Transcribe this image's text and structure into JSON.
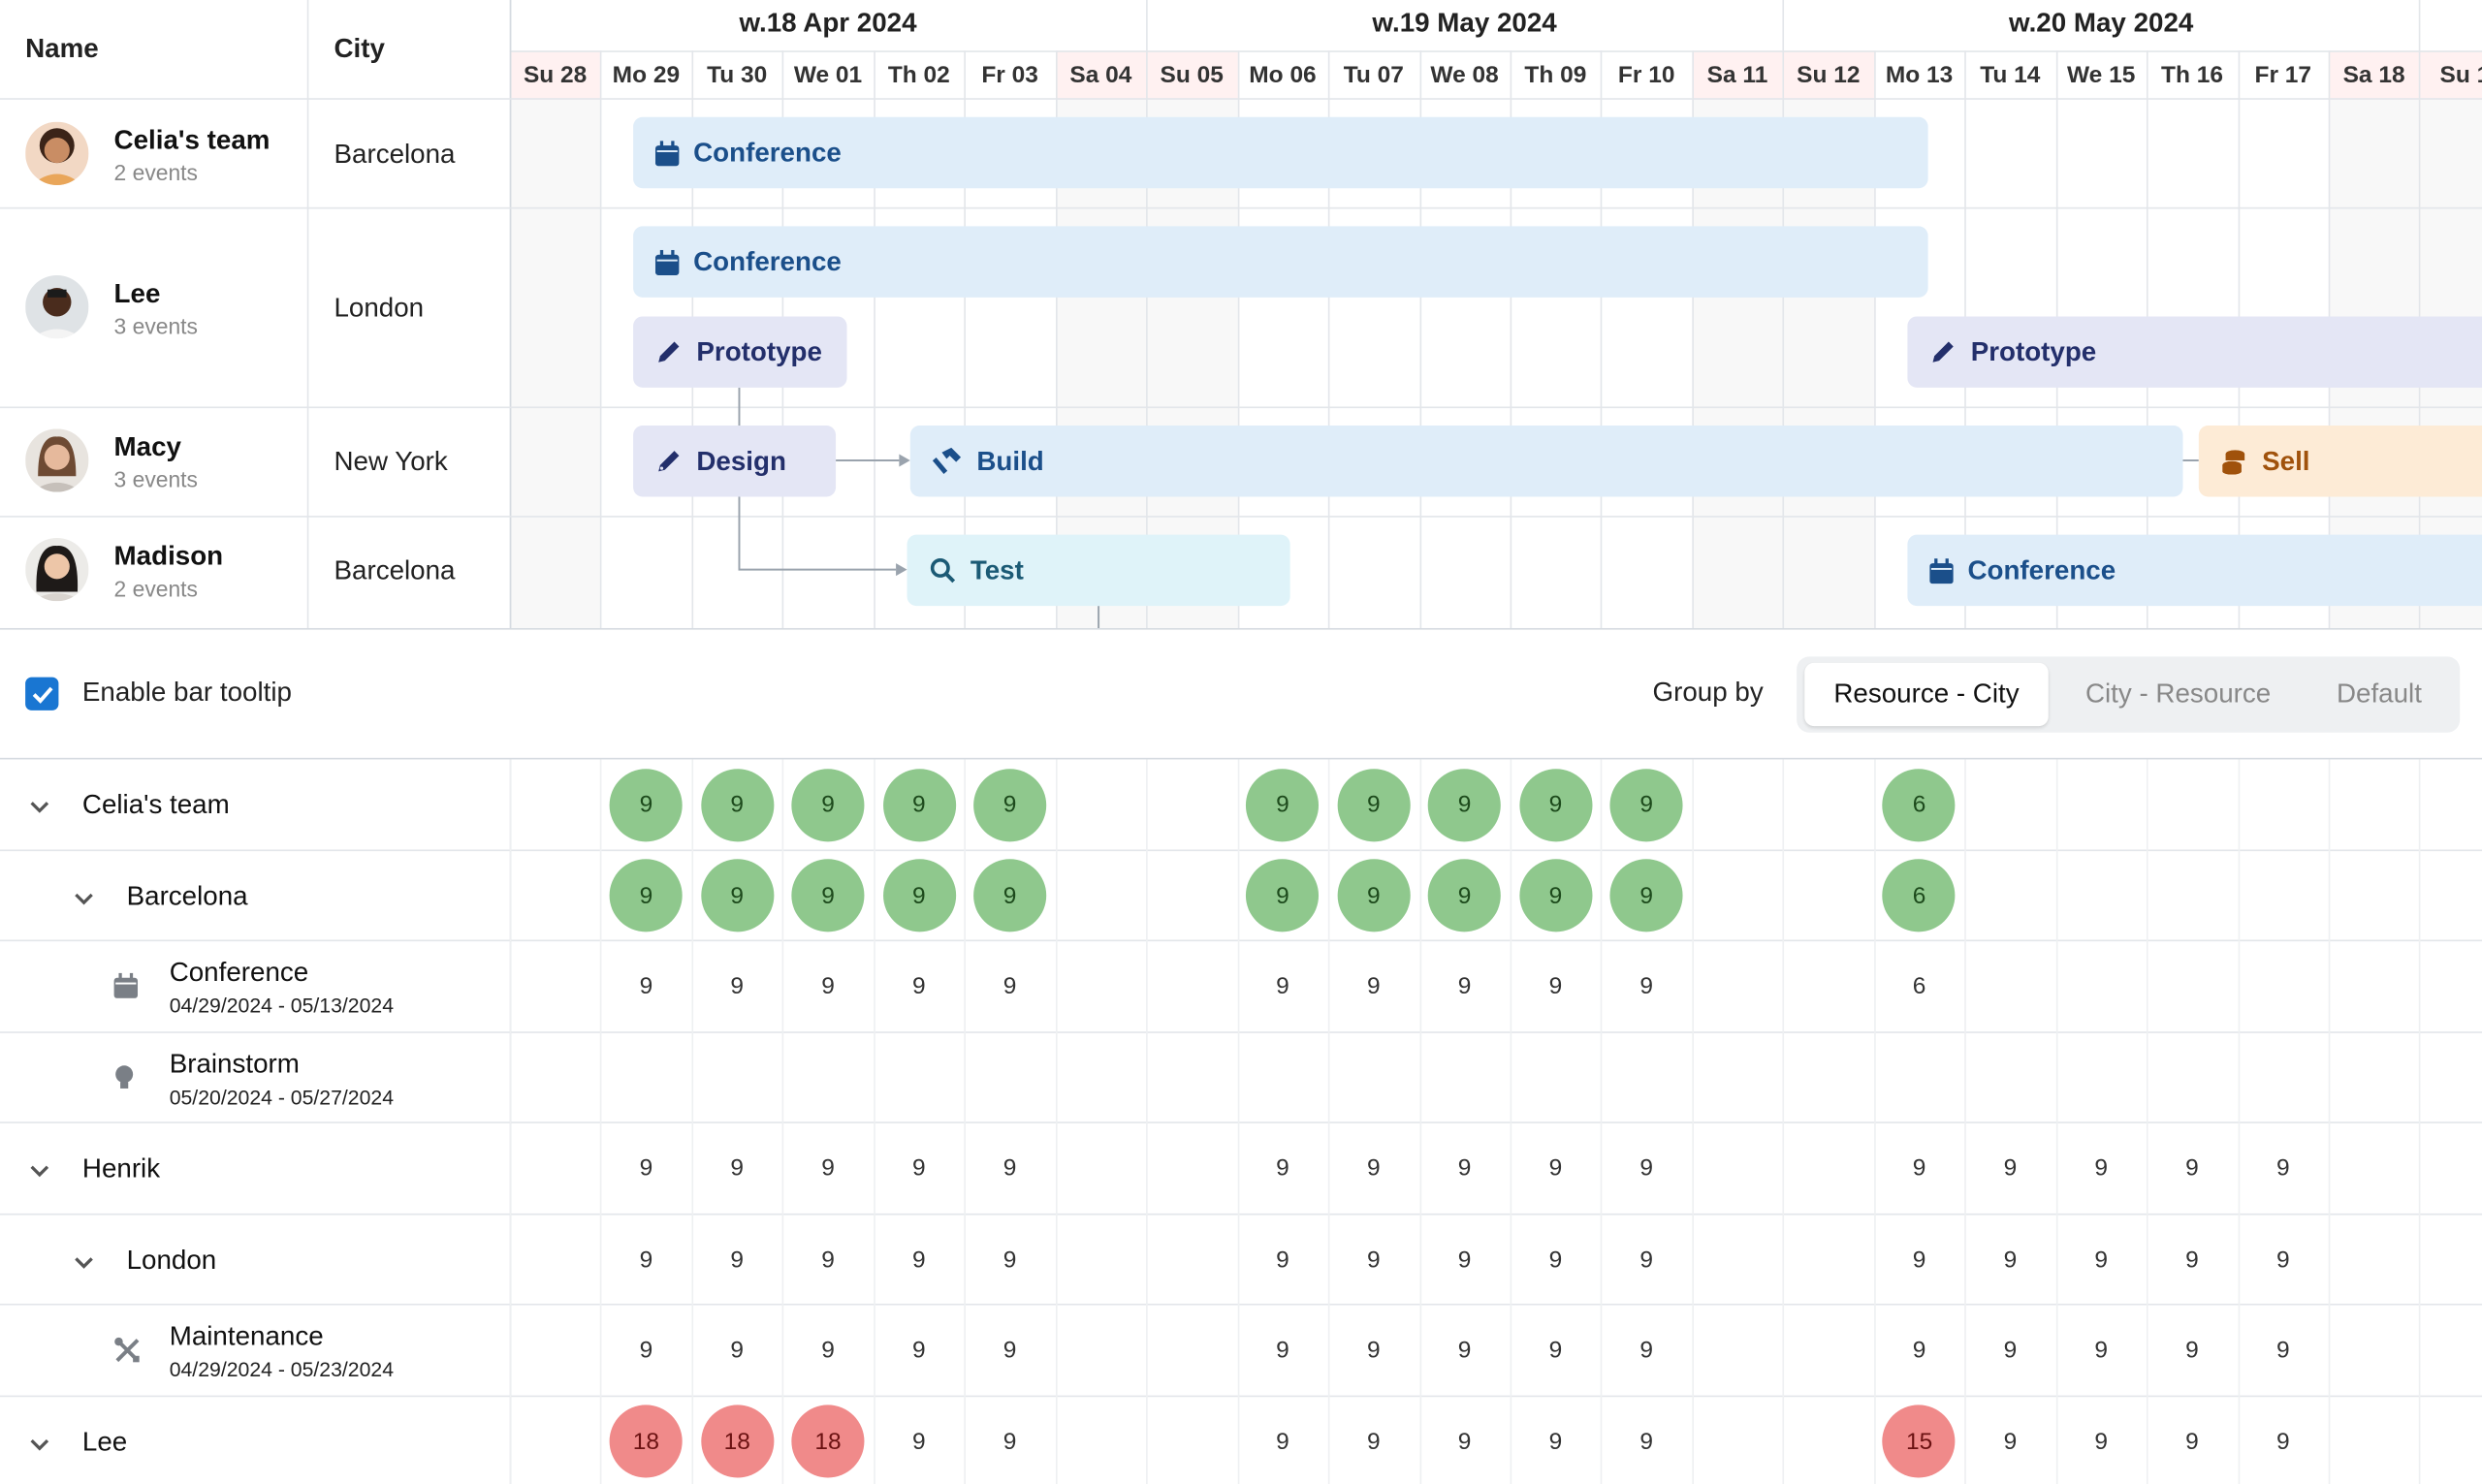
{
  "scheduler": {
    "headers": {
      "name": "Name",
      "city": "City"
    },
    "weeks": [
      "w.18 Apr 2024",
      "w.19 May 2024",
      "w.20 May 2024"
    ],
    "days": [
      "Su 28",
      "Mo 29",
      "Tu 30",
      "We 01",
      "Th 02",
      "Fr 03",
      "Sa 04",
      "Su 05",
      "Mo 06",
      "Tu 07",
      "We 08",
      "Th 09",
      "Fr 10",
      "Sa 11",
      "Su 12",
      "Mo 13",
      "Tu 14",
      "We 15",
      "Th 16",
      "Fr 17",
      "Sa 18",
      "Su 1"
    ],
    "resources": [
      {
        "name": "Celia's team",
        "events": "2 events",
        "city": "Barcelona"
      },
      {
        "name": "Lee",
        "events": "3 events",
        "city": "London"
      },
      {
        "name": "Macy",
        "events": "3 events",
        "city": "New York"
      },
      {
        "name": "Madison",
        "events": "2 events",
        "city": "Barcelona"
      }
    ],
    "events": {
      "celia_conference": "Conference",
      "lee_conference": "Conference",
      "lee_prototype_1": "Prototype",
      "lee_prototype_2": "Prototype",
      "macy_design": "Design",
      "macy_build": "Build",
      "macy_sell": "Sell",
      "madison_test": "Test",
      "madison_conference": "Conference"
    }
  },
  "toolbar": {
    "tooltip_label": "Enable bar tooltip",
    "tooltip_checked": true,
    "group_by_label": "Group by",
    "group_options": [
      "Resource - City",
      "City - Resource",
      "Default"
    ],
    "group_selected": "Resource - City"
  },
  "summary": {
    "rows": [
      {
        "label": "Celia's team",
        "level": 0,
        "style": "green",
        "values": [
          "",
          "9",
          "9",
          "9",
          "9",
          "9",
          "",
          "",
          "9",
          "9",
          "9",
          "9",
          "9",
          "",
          "",
          "6",
          "",
          "",
          "",
          "",
          "",
          ""
        ]
      },
      {
        "label": "Barcelona",
        "level": 1,
        "style": "green",
        "values": [
          "",
          "9",
          "9",
          "9",
          "9",
          "9",
          "",
          "",
          "9",
          "9",
          "9",
          "9",
          "9",
          "",
          "",
          "6",
          "",
          "",
          "",
          "",
          "",
          ""
        ]
      },
      {
        "label": "Conference",
        "dates": "04/29/2024 - 05/13/2024",
        "icon": "calendar-icon",
        "level": 2,
        "values": [
          "",
          "9",
          "9",
          "9",
          "9",
          "9",
          "",
          "",
          "9",
          "9",
          "9",
          "9",
          "9",
          "",
          "",
          "6",
          "",
          "",
          "",
          "",
          "",
          ""
        ]
      },
      {
        "label": "Brainstorm",
        "dates": "05/20/2024 - 05/27/2024",
        "icon": "lightbulb-icon",
        "level": 2,
        "values": [
          "",
          "",
          "",
          "",
          "",
          "",
          "",
          "",
          "",
          "",
          "",
          "",
          "",
          "",
          "",
          "",
          "",
          "",
          "",
          "",
          "",
          ""
        ]
      },
      {
        "label": "Henrik",
        "level": 0,
        "style": "plain",
        "values": [
          "",
          "9",
          "9",
          "9",
          "9",
          "9",
          "",
          "",
          "9",
          "9",
          "9",
          "9",
          "9",
          "",
          "",
          "9",
          "9",
          "9",
          "9",
          "9",
          "",
          ""
        ]
      },
      {
        "label": "London",
        "level": 1,
        "style": "plain",
        "values": [
          "",
          "9",
          "9",
          "9",
          "9",
          "9",
          "",
          "",
          "9",
          "9",
          "9",
          "9",
          "9",
          "",
          "",
          "9",
          "9",
          "9",
          "9",
          "9",
          "",
          ""
        ]
      },
      {
        "label": "Maintenance",
        "dates": "04/29/2024 - 05/23/2024",
        "icon": "tools-icon",
        "level": 2,
        "values": [
          "",
          "9",
          "9",
          "9",
          "9",
          "9",
          "",
          "",
          "9",
          "9",
          "9",
          "9",
          "9",
          "",
          "",
          "9",
          "9",
          "9",
          "9",
          "9",
          "",
          ""
        ]
      },
      {
        "label": "Lee",
        "level": 0,
        "style": "mixed",
        "values": [
          "",
          "18",
          "18",
          "18",
          "9",
          "9",
          "",
          "",
          "9",
          "9",
          "9",
          "9",
          "9",
          "",
          "",
          "15",
          "9",
          "9",
          "9",
          "9",
          "",
          ""
        ]
      }
    ]
  },
  "colors": {
    "accent": "#1976d2",
    "overload": "#f08a8a",
    "ok": "#8fc88d",
    "conference_bar": "#dfedf9",
    "prototype_bar": "#e4e6f5",
    "test_bar": "#dff3f9",
    "sell_bar": "#fdebd6"
  }
}
